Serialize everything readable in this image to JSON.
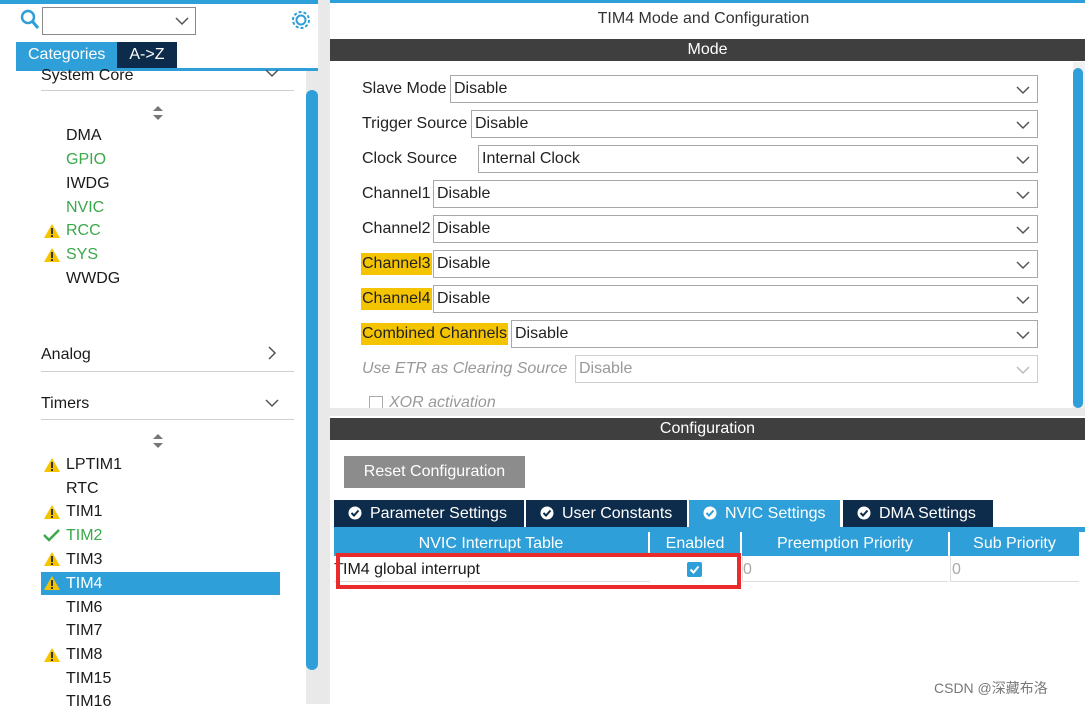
{
  "sidebar": {
    "search_placeholder": "",
    "tabs": {
      "categories": "Categories",
      "atoz": "A->Z"
    },
    "system_core": "System Core",
    "system_core_items": [
      "DMA",
      "GPIO",
      "IWDG",
      "NVIC",
      "RCC",
      "SYS",
      "WWDG"
    ],
    "analog": "Analog",
    "timers": "Timers",
    "timer_items": [
      "LPTIM1",
      "RTC",
      "TIM1",
      "TIM2",
      "TIM3",
      "TIM4",
      "TIM6",
      "TIM7",
      "TIM8",
      "TIM15",
      "TIM16"
    ],
    "selected": "TIM4"
  },
  "panel": {
    "title": "TIM4 Mode and Configuration",
    "mode_header": "Mode",
    "config_header": "Configuration"
  },
  "mode": {
    "slave_mode": {
      "label": "Slave Mode",
      "value": "Disable"
    },
    "trigger_source": {
      "label": "Trigger Source",
      "value": "Disable"
    },
    "clock_source": {
      "label": "Clock Source",
      "value": "Internal Clock"
    },
    "channel1": {
      "label": "Channel1",
      "value": "Disable"
    },
    "channel2": {
      "label": "Channel2",
      "value": "Disable"
    },
    "channel3": {
      "label": "Channel3",
      "value": "Disable"
    },
    "channel4": {
      "label": "Channel4",
      "value": "Disable"
    },
    "combined": {
      "label": "Combined Channels",
      "value": "Disable"
    },
    "etr": {
      "label": "Use ETR as Clearing Source",
      "value": "Disable"
    },
    "xor": {
      "label": "XOR activation"
    }
  },
  "config": {
    "reset_button": "Reset Configuration",
    "tabs": [
      "Parameter Settings",
      "User Constants",
      "NVIC Settings",
      "DMA Settings"
    ],
    "active_tab": "NVIC Settings",
    "table": {
      "headers": [
        "NVIC Interrupt Table",
        "Enabled",
        "Preemption Priority",
        "Sub Priority"
      ],
      "rows": [
        {
          "name": "IM4 global interrupt",
          "row_marker": "T",
          "enabled": true,
          "preemption": "0",
          "sub": "0"
        }
      ]
    }
  },
  "watermark": "CSDN @深藏布洛",
  "colors": {
    "accent": "#2e9fd8",
    "navy": "#0d2b4a",
    "header": "#3f3f3f",
    "highlight": "#f5c400",
    "green": "#3ba84a",
    "warning": "#f5c400",
    "annotation_box": "#ea2b2b"
  }
}
